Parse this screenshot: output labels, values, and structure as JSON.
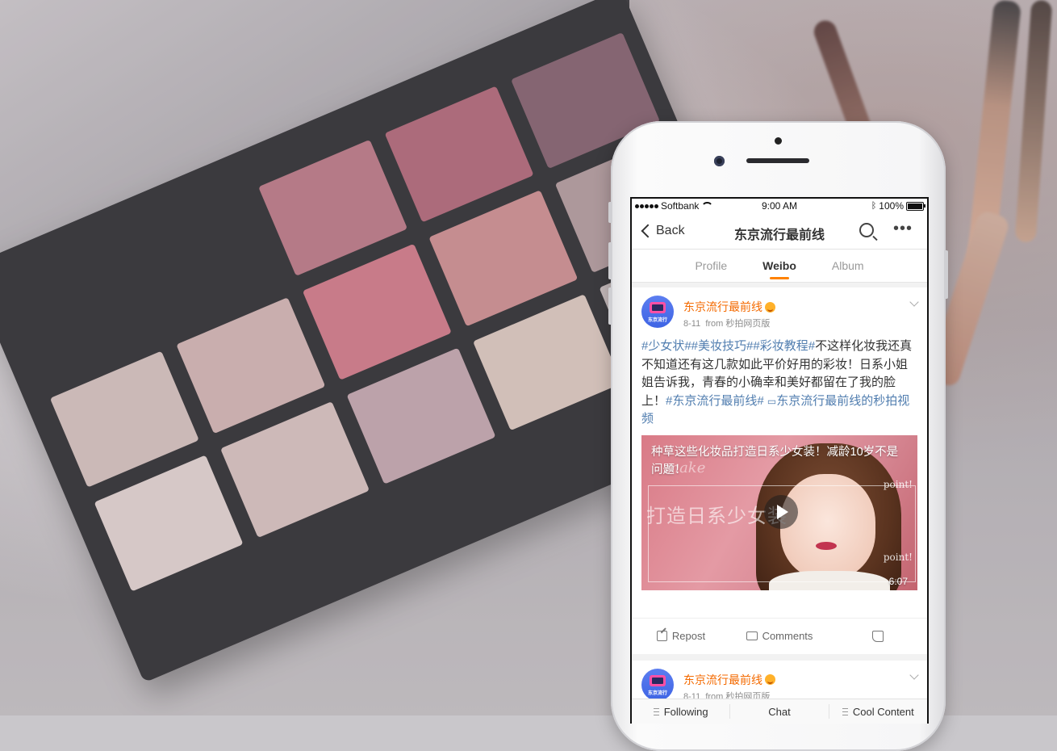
{
  "status_bar": {
    "carrier": "Softbank",
    "time": "9:00 AM",
    "battery": "100%"
  },
  "nav": {
    "back_label": "Back",
    "title": "东京流行最前线",
    "search_icon": "search-icon",
    "more_icon": "more-icon"
  },
  "tabs": [
    {
      "label": "Profile",
      "active": false
    },
    {
      "label": "Weibo",
      "active": true
    },
    {
      "label": "Album",
      "active": false
    }
  ],
  "post": {
    "avatar_text": "东京流行",
    "author": "东京流行最前线",
    "date": "8-11",
    "source": "from 秒拍网页版",
    "text": {
      "tags": "#少女状##美妆技巧##彩妆教程#",
      "body": "不这样化妆我还真不知道还有这几款如此平价好用的彩妆！日系小姐姐告诉我，青春的小确幸和美好都留在了我的脸上！",
      "tag_end": "#东京流行最前线#",
      "link": "东京流行最前线的秒拍视频"
    },
    "video": {
      "title": "种草这些化妆品打造日系少女装！减龄10岁不是问题！",
      "overlay_text": "打造日系少女装",
      "make_text": "make",
      "point_text_1": "point!",
      "point_text_2": "point!",
      "duration": "6:07"
    },
    "actions": {
      "repost": "Repost",
      "comments": "Comments"
    }
  },
  "post2": {
    "avatar_text": "东京流行",
    "author": "东京流行最前线",
    "date": "8-11",
    "source": "from 秒拍网页版"
  },
  "bottom_bar": {
    "following": "Following",
    "chat": "Chat",
    "cool_content": "Cool Content"
  },
  "colors": {
    "accent": "#ff8200",
    "author": "#f46a00",
    "link": "#507daf"
  }
}
